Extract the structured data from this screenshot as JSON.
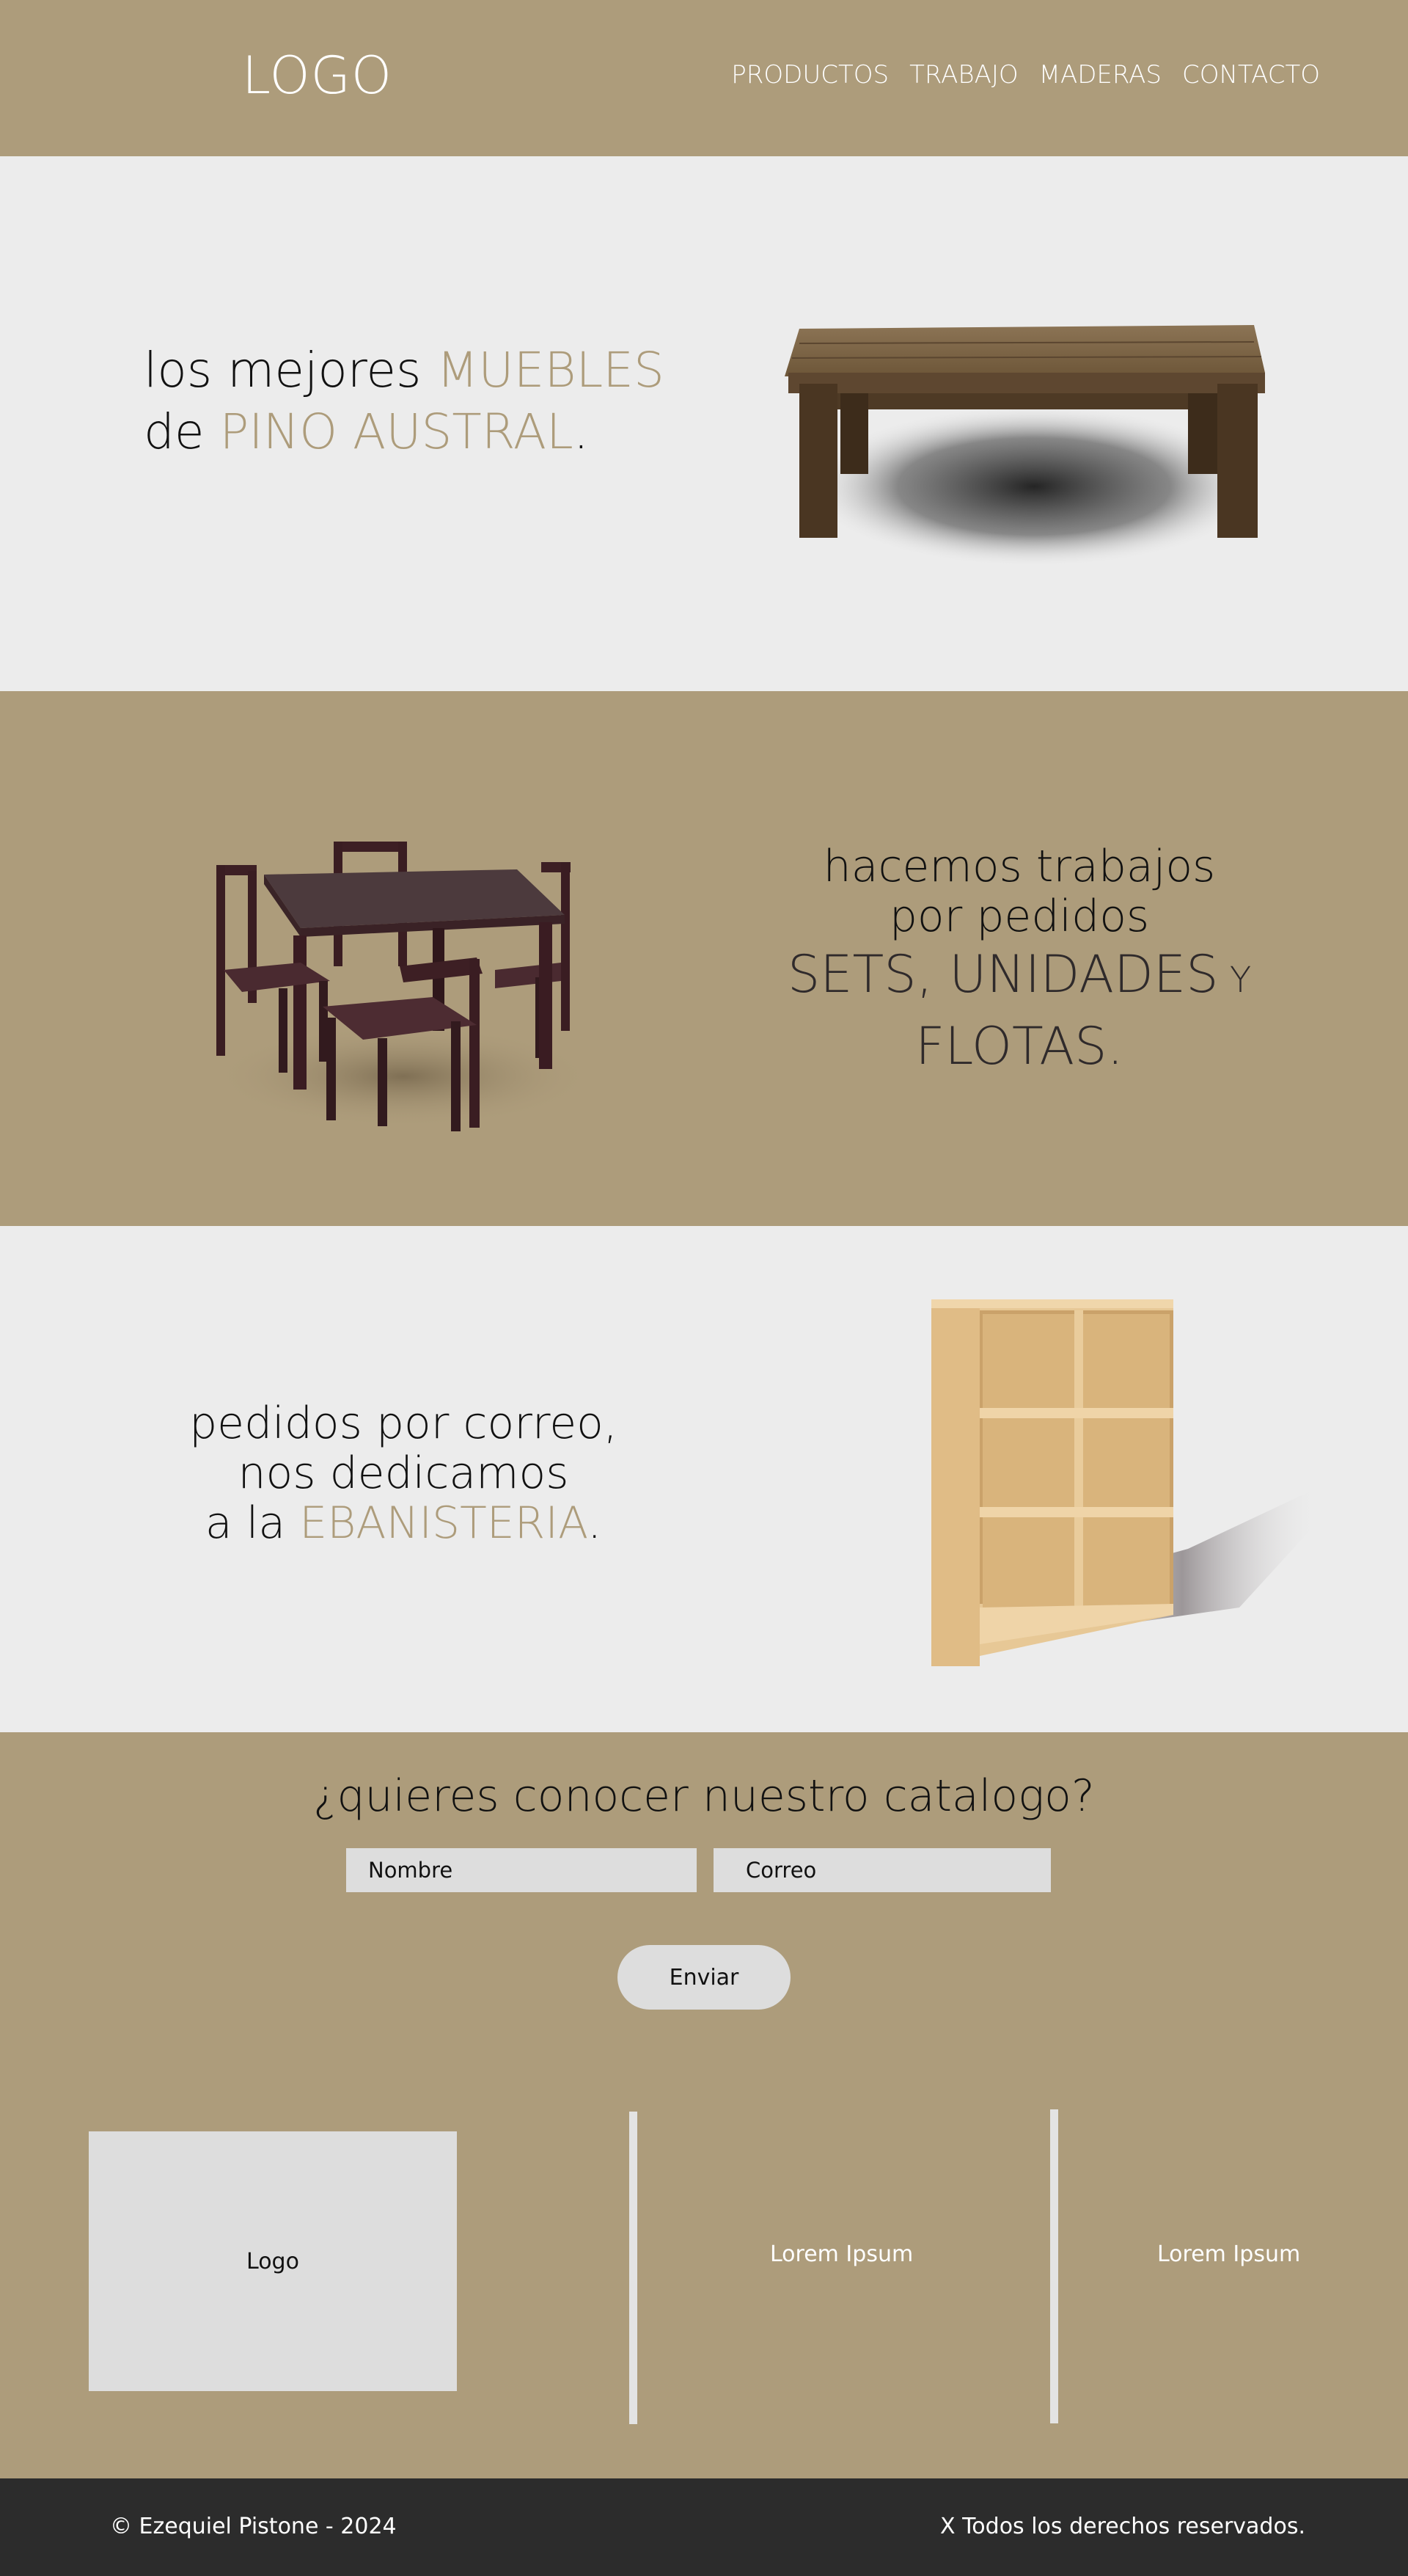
{
  "header": {
    "logo": "LOGO",
    "nav": [
      "PRODUCTOS",
      "TRABAJO",
      "MADERAS",
      "CONTACTO"
    ]
  },
  "hero": {
    "line1_pre": "los mejores ",
    "line1_accent": "MUEBLES",
    "line2_pre": "de ",
    "line2_accent": "PINO AUSTRAL",
    "line2_post": "."
  },
  "orders": {
    "line1": "hacemos trabajos",
    "line2": "por pedidos",
    "w1": "SETS, UNIDADES",
    "w2": " Y ",
    "w3": "FLOTAS."
  },
  "mail": {
    "line1": "pedidos por correo,",
    "line2": "nos dedicamos",
    "line3_pre": "a la ",
    "line3_accent": "EBANISTERIA",
    "line3_post": "."
  },
  "catalog": {
    "title": "¿quieres conocer nuestro catalogo?",
    "name_placeholder": "Nombre",
    "email_placeholder": "Correo",
    "send_label": "Enviar"
  },
  "bottom": {
    "logo_box": "Logo",
    "lorem1": "Lorem Ipsum",
    "lorem2": "Lorem Ipsum"
  },
  "footer": {
    "copyright": "© Ezequiel Pistone - 2024",
    "rights": "X Todos los derechos reservados."
  },
  "colors": {
    "accent": "#ad9c7b",
    "light_bg": "#ececec",
    "footer_bg": "#2c2c2c"
  }
}
